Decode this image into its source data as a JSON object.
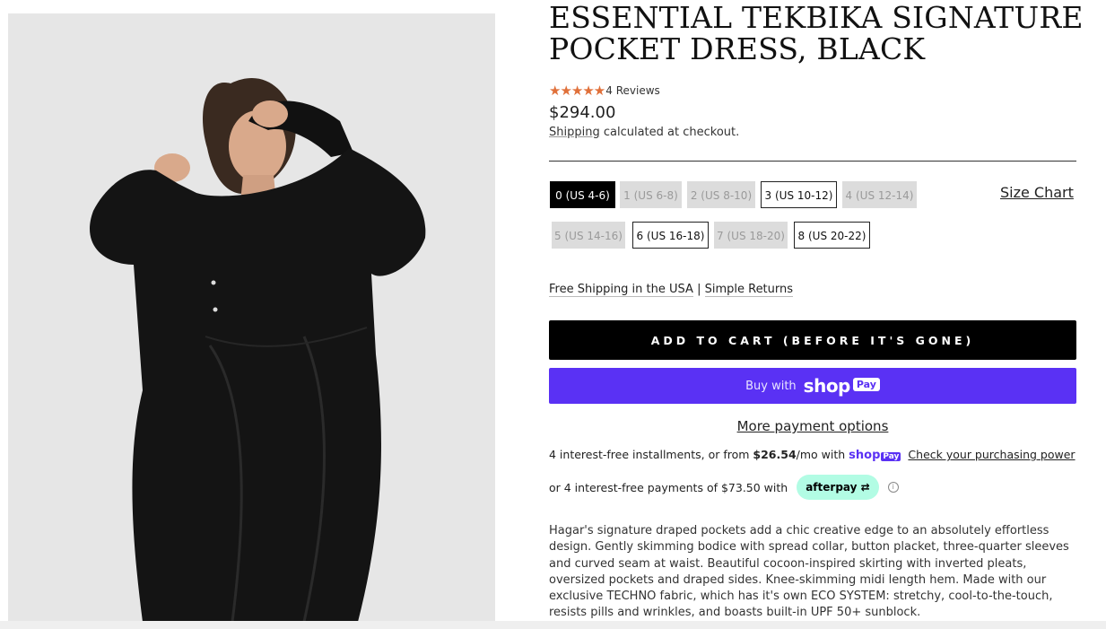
{
  "product": {
    "title_line1": "ESSENTIAL TEKBIKA SIGNATURE",
    "title_line2": "POCKET DRESS, BLACK",
    "rating_stars": 5,
    "reviews_label": "4 Reviews",
    "price": "$294.00",
    "shipping_link": "Shipping",
    "shipping_rest": " calculated at checkout."
  },
  "sizes": [
    {
      "label": "0 (US 4-6)",
      "state": "selected"
    },
    {
      "label": "1 (US 6-8)",
      "state": "unavailable"
    },
    {
      "label": "2 (US 8-10)",
      "state": "unavailable"
    },
    {
      "label": "3 (US 10-12)",
      "state": "available"
    },
    {
      "label": "4 (US 12-14)",
      "state": "unavailable"
    },
    {
      "label": "5 (US 14-16)",
      "state": "unavailable"
    },
    {
      "label": "6 (US 16-18)",
      "state": "available"
    },
    {
      "label": "7 (US 18-20)",
      "state": "unavailable"
    },
    {
      "label": "8 (US 20-22)",
      "state": "available"
    }
  ],
  "size_chart_label": "Size Chart",
  "promo": {
    "free_shipping": "Free Shipping in the USA",
    "separator": "|",
    "returns": "Simple Returns"
  },
  "buttons": {
    "add_to_cart": "ADD TO CART (BEFORE IT'S GONE)",
    "buy_with": "Buy with",
    "shop_word": "shop",
    "pay_badge": "Pay",
    "more_payment": "More payment options"
  },
  "installments": {
    "prefix": "4 interest-free installments, or from ",
    "amount": "$26.54",
    "suffix": "/mo with",
    "check_link": "Check your purchasing power"
  },
  "afterpay": {
    "text": "or 4 interest-free payments of $73.50 with",
    "badge": "afterpay"
  },
  "description": "Hagar's signature draped pockets add a chic creative edge to an absolutely effortless design. Gently skimming bodice with spread collar, button placket, three-quarter sleeves and curved seam at waist. Beautiful cocoon-inspired skirting with inverted pleats, oversized pockets and draped sides. Knee-skimming midi length hem. Made with our exclusive TECHNO fabric, which has it's own ECO SYSTEM: stretchy, cool-to-the-touch, resists pills and wrinkles, and boasts built-in UPF 50+ sunblock.",
  "colors": {
    "star": "#e0703a",
    "shop_pay": "#5a31f4",
    "afterpay": "#b2fce4",
    "size_selected": "#000000",
    "size_unavailable": "#dcdcdc"
  }
}
